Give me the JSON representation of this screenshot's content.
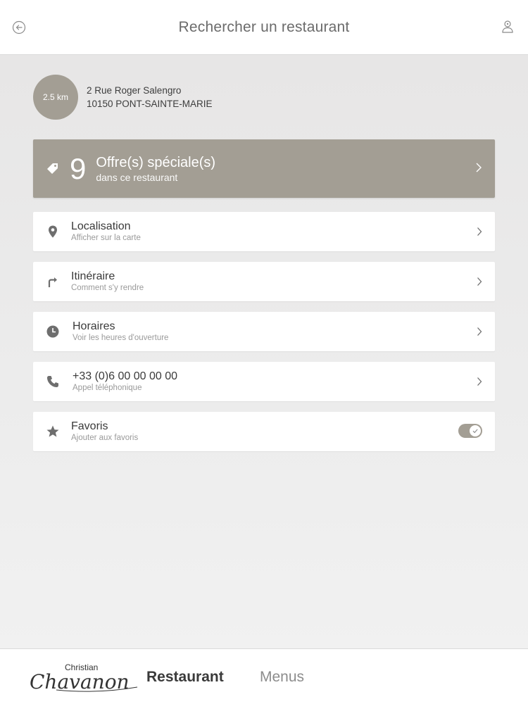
{
  "header": {
    "title": "Rechercher un restaurant",
    "back_icon": "back-arrow-icon",
    "user_icon": "user-location-icon"
  },
  "address": {
    "distance": "2.5 km",
    "line1": "2 Rue Roger Salengro",
    "line2": "10150 PONT-SAINTE-MARIE"
  },
  "offers": {
    "count": "9",
    "label": "Offre(s) spéciale(s)",
    "sublabel": "dans ce restaurant",
    "icon": "tag-icon"
  },
  "rows": [
    {
      "label": "Localisation",
      "sublabel": "Afficher sur la carte",
      "icon": "location-pin-icon"
    },
    {
      "label": "Itinéraire",
      "sublabel": "Comment s'y rendre",
      "icon": "turn-right-icon"
    },
    {
      "label": "Horaires",
      "sublabel": "Voir les heures d'ouverture",
      "icon": "clock-icon"
    },
    {
      "label": "+33 (0)6 00 00 00 00",
      "sublabel": "Appel téléphonique",
      "icon": "phone-icon"
    },
    {
      "label": "Favoris",
      "sublabel": "Ajouter aux favoris",
      "icon": "star-icon",
      "toggle_on": true
    }
  ],
  "footer": {
    "logo_line1": "Christian",
    "logo_line2": "Chavanon",
    "tab_restaurant": "Restaurant",
    "tab_menus": "Menus"
  },
  "colors": {
    "accent": "#a39e94",
    "background": "#ebebeb",
    "text": "#3a3a3a"
  }
}
